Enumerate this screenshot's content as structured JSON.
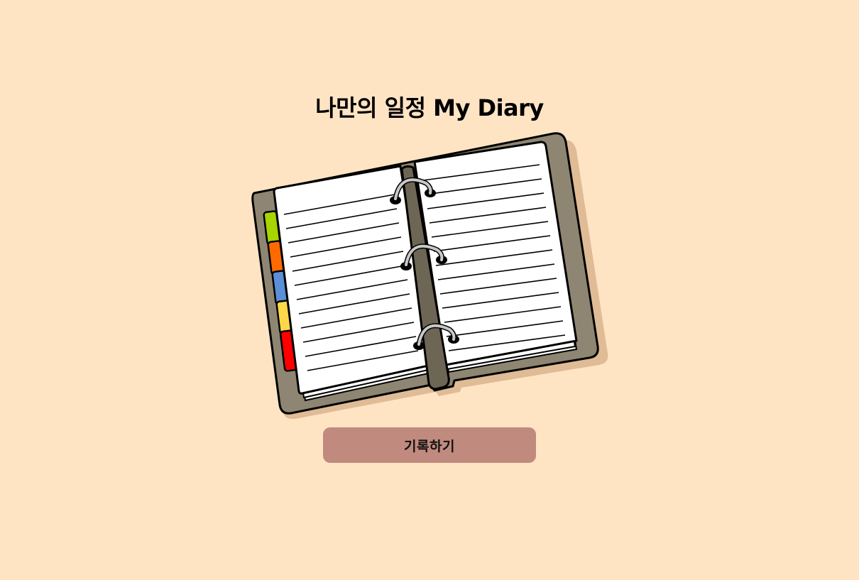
{
  "page": {
    "title": "나만의 일정 My Diary",
    "background_color": "#FFE4C4"
  },
  "illustration": {
    "icon": "open-diary-icon",
    "tab_colors": [
      "#A8D400",
      "#FF6A00",
      "#5B8FD6",
      "#FFD84A",
      "#FF0000"
    ]
  },
  "actions": {
    "record_label": "기록하기",
    "record_color": "#C08A7E"
  }
}
